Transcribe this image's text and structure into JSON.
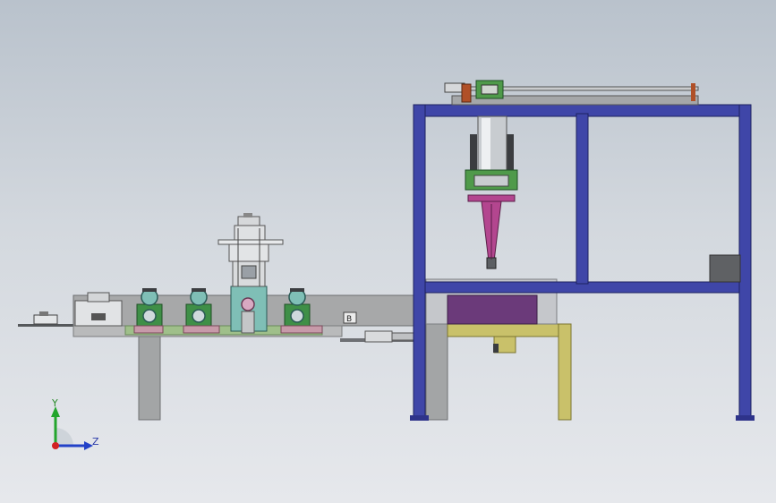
{
  "viewport": {
    "triad": {
      "y_label": "Y",
      "z_label": "Z"
    },
    "labels": {
      "box_mark": "B"
    }
  },
  "colors": {
    "frame_blue": "#3f46a8",
    "table_gray": "#a7a8a9",
    "leg_gray": "#a3a5a6",
    "roller_teal": "#7fbfb6",
    "roller_green": "#4f9a4a",
    "stand_base_pink": "#c79aa9",
    "magenta_part": "#b3468f",
    "purple_block": "#6b3a7a",
    "olive_frame": "#c9c16a",
    "cylinder_silver": "#c8ccd0",
    "axis_red": "#d22222",
    "axis_green": "#22a52c",
    "axis_blue": "#2241c8"
  }
}
